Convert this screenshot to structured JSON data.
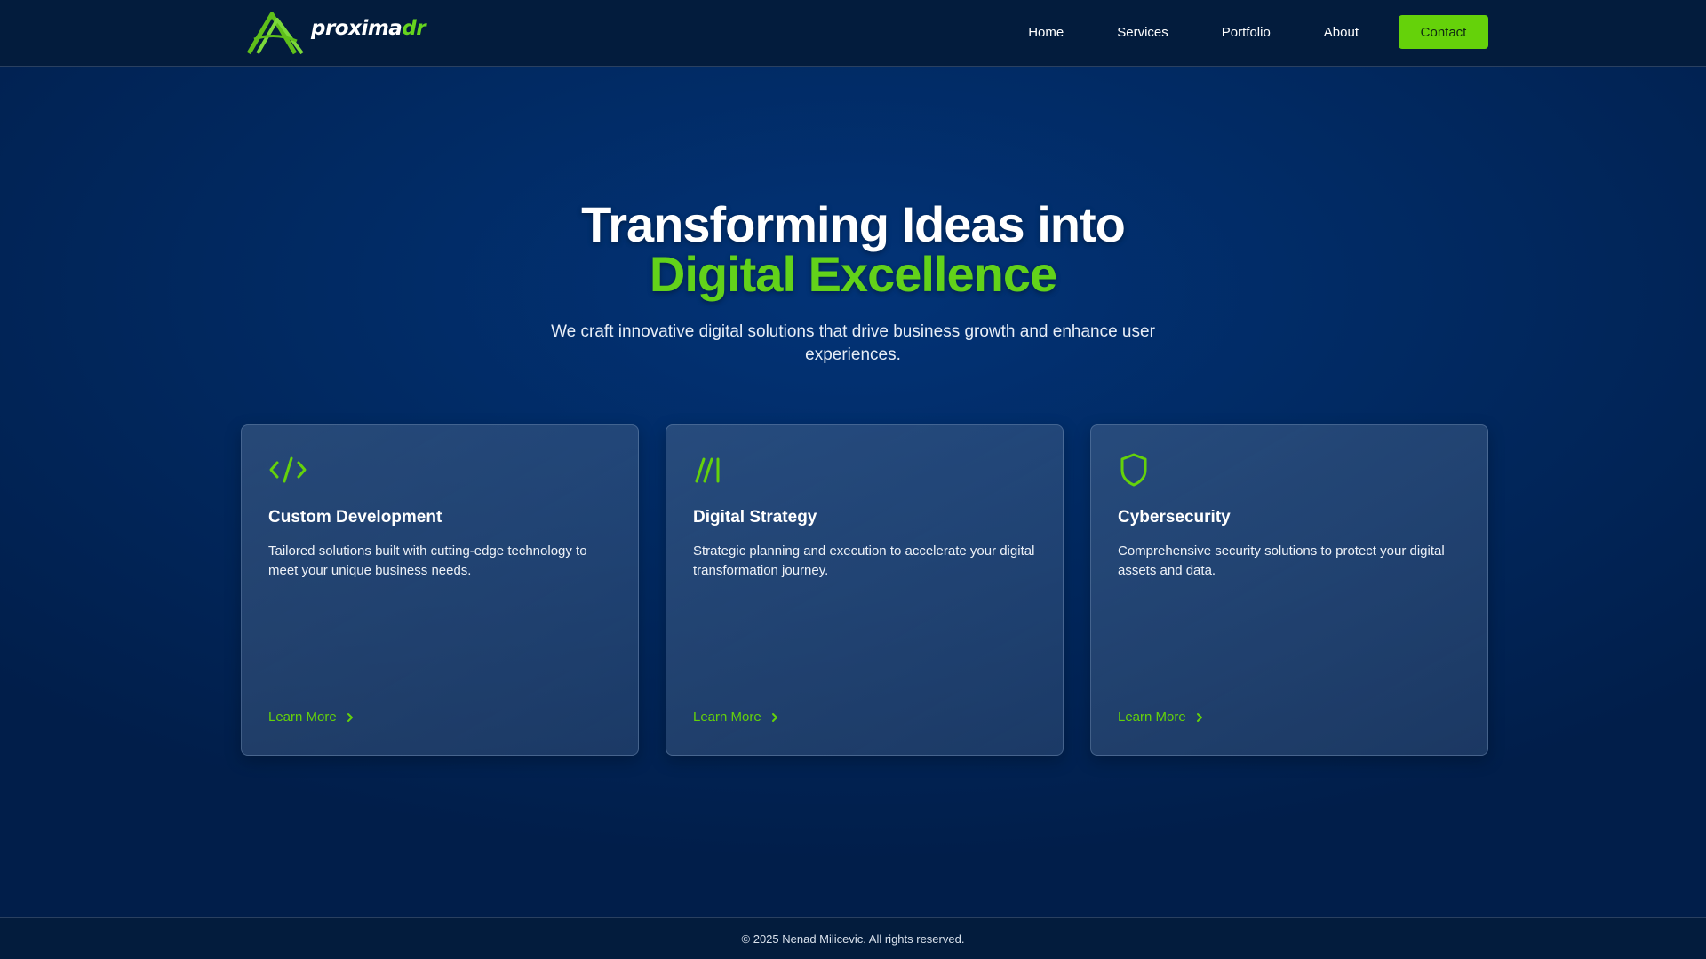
{
  "brand": {
    "name_part1": "proxima",
    "name_part2": "dr",
    "accent_color": "#65d20a",
    "logo_icon": "mountain-a-logo-icon"
  },
  "nav": {
    "links": [
      "Home",
      "Services",
      "Portfolio",
      "About"
    ],
    "contact_label": "Contact"
  },
  "hero": {
    "title_line1": "Transforming Ideas into",
    "title_line2": "Digital Excellence",
    "subtitle": "We craft innovative digital solutions that drive business growth and enhance user experiences."
  },
  "cards": [
    {
      "icon": "code-icon",
      "title": "Custom Development",
      "description": "Tailored solutions built with cutting-edge technology to meet your unique business needs.",
      "link": "Learn More"
    },
    {
      "icon": "slashes-icon",
      "title": "Digital Strategy",
      "description": "Strategic planning and execution to accelerate your digital transformation journey.",
      "link": "Learn More"
    },
    {
      "icon": "shield-icon",
      "title": "Cybersecurity",
      "description": "Comprehensive security solutions to protect your digital assets and data.",
      "link": "Learn More"
    }
  ],
  "footer": {
    "copyright": "© 2025 Nenad Milicevic. All rights reserved."
  }
}
